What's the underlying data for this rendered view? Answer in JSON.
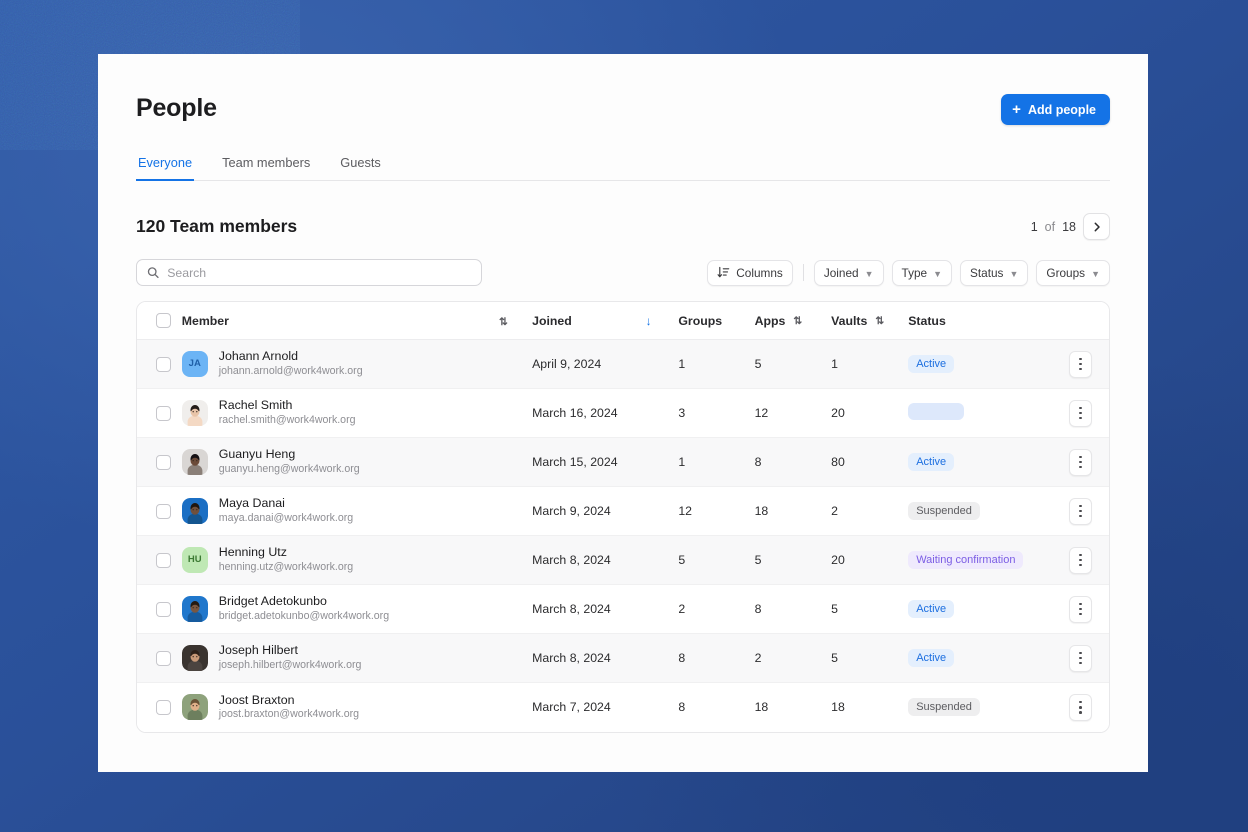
{
  "header": {
    "title": "People",
    "add_button": "Add people",
    "plus_icon": "plus-icon"
  },
  "tabs": [
    {
      "label": "Everyone",
      "active": true
    },
    {
      "label": "Team members",
      "active": false
    },
    {
      "label": "Guests",
      "active": false
    }
  ],
  "summary": {
    "count_title": "120 Team members",
    "page_current": "1",
    "page_of": "of",
    "page_total": "18",
    "next_icon": "chevron-right-icon"
  },
  "search": {
    "placeholder": "Search",
    "value": "",
    "icon": "search-icon"
  },
  "filters": [
    {
      "label": "Columns",
      "icon": "sort-lines-icon",
      "caret": false
    },
    {
      "label": "Joined",
      "icon": "",
      "caret": true
    },
    {
      "label": "Type",
      "icon": "",
      "caret": true
    },
    {
      "label": "Status",
      "icon": "",
      "caret": true
    },
    {
      "label": "Groups",
      "icon": "",
      "caret": true
    }
  ],
  "table": {
    "columns": [
      {
        "key": "member",
        "label": "Member",
        "sortable": true,
        "sort_state": "none"
      },
      {
        "key": "joined",
        "label": "Joined",
        "sortable": true,
        "sort_state": "desc"
      },
      {
        "key": "groups",
        "label": "Groups",
        "sortable": false,
        "sort_state": "none"
      },
      {
        "key": "apps",
        "label": "Apps",
        "sortable": true,
        "sort_state": "none"
      },
      {
        "key": "vaults",
        "label": "Vaults",
        "sortable": true,
        "sort_state": "none"
      },
      {
        "key": "status",
        "label": "Status",
        "sortable": false,
        "sort_state": "none"
      }
    ],
    "rows": [
      {
        "name": "Johann Arnold",
        "email": "johann.arnold@work4work.org",
        "avatar_type": "initials",
        "initials": "JA",
        "avatar_bg": "#6cb4f5",
        "avatar_fg": "#1f5fa8",
        "joined": "April 9, 2024",
        "groups": "1",
        "apps": "5",
        "vaults": "1",
        "status": "Active",
        "status_kind": "active"
      },
      {
        "name": "Rachel Smith",
        "email": "rachel.smith@work4work.org",
        "avatar_type": "photo",
        "photo_skin": "#e8c4a8",
        "photo_hair": "#241c18",
        "photo_bg": "#f0eeec",
        "photo_shirt": "#f4d9c4",
        "joined": "March 16, 2024",
        "groups": "3",
        "apps": "12",
        "vaults": "20",
        "status": "",
        "status_kind": "blank"
      },
      {
        "name": "Guanyu Heng",
        "email": "guanyu.heng@work4work.org",
        "avatar_type": "photo",
        "photo_skin": "#6b4a38",
        "photo_hair": "#151013",
        "photo_bg": "#d9d6d4",
        "photo_shirt": "#8a7f78",
        "joined": "March 15, 2024",
        "groups": "1",
        "apps": "8",
        "vaults": "80",
        "status": "Active",
        "status_kind": "active"
      },
      {
        "name": "Maya Danai",
        "email": "maya.danai@work4work.org",
        "avatar_type": "photo",
        "photo_skin": "#70503c",
        "photo_hair": "#20160f",
        "photo_bg": "#1b6fc4",
        "photo_shirt": "#14558f",
        "joined": "March 9, 2024",
        "groups": "12",
        "apps": "18",
        "vaults": "2",
        "status": "Suspended",
        "status_kind": "suspended"
      },
      {
        "name": "Henning Utz",
        "email": "henning.utz@work4work.org",
        "avatar_type": "initials",
        "initials": "HU",
        "avatar_bg": "#bfe8b4",
        "avatar_fg": "#3c7a33",
        "joined": "March 8, 2024",
        "groups": "5",
        "apps": "5",
        "vaults": "20",
        "status": "Waiting confirmation",
        "status_kind": "waiting"
      },
      {
        "name": "Bridget Adetokunbo",
        "email": "bridget.adetokunbo@work4work.org",
        "avatar_type": "photo",
        "photo_skin": "#7a5740",
        "photo_hair": "#241a12",
        "photo_bg": "#2077cc",
        "photo_shirt": "#165b9e",
        "joined": "March 8, 2024",
        "groups": "2",
        "apps": "8",
        "vaults": "5",
        "status": "Active",
        "status_kind": "active"
      },
      {
        "name": "Joseph Hilbert",
        "email": "joseph.hilbert@work4work.org",
        "avatar_type": "photo",
        "photo_skin": "#c99a78",
        "photo_hair": "#2e2119",
        "photo_bg": "#3a3430",
        "photo_shirt": "#4b4440",
        "joined": "March 8, 2024",
        "groups": "8",
        "apps": "2",
        "vaults": "5",
        "status": "Active",
        "status_kind": "active"
      },
      {
        "name": "Joost Braxton",
        "email": "joost.braxton@work4work.org",
        "avatar_type": "photo",
        "photo_skin": "#dfb089",
        "photo_hair": "#6a5336",
        "photo_bg": "#8ea27c",
        "photo_shirt": "#6d7f5e",
        "joined": "March 7, 2024",
        "groups": "8",
        "apps": "18",
        "vaults": "18",
        "status": "Suspended",
        "status_kind": "suspended"
      }
    ],
    "row_menu_icon": "kebab-menu-icon",
    "select_all_checkbox": "unchecked"
  },
  "colors": {
    "accent": "#1473e6",
    "backdrop": "#2d559f",
    "card": "#fdfdfd",
    "active_badge": "#1d6fe0",
    "waiting_badge": "#7b5de4",
    "suspended_badge": "#5c5c60"
  }
}
